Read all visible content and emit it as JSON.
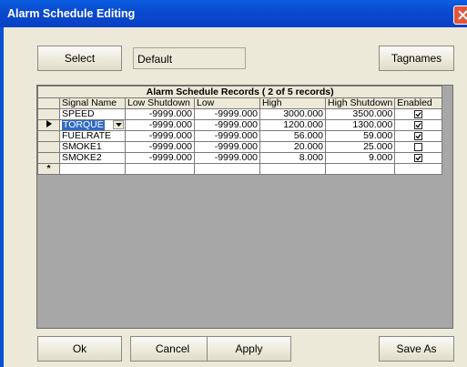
{
  "window": {
    "title": "Alarm Schedule Editing",
    "accent": "#0a4bd0"
  },
  "top": {
    "select_label": "Select",
    "schedule_value": "Default",
    "tagnames_label": "Tagnames"
  },
  "grid": {
    "caption": "Alarm Schedule Records ( 2 of 5 records)",
    "columns": [
      "Signal Name",
      "Low Shutdown",
      "Low",
      "High",
      "High Shutdown",
      "Enabled"
    ],
    "rows": [
      {
        "signal": "SPEED",
        "low_shutdown": "-9999.000",
        "low": "-9999.000",
        "high": "3000.000",
        "high_shutdown": "3500.000",
        "enabled": true,
        "current": false
      },
      {
        "signal": "TORQUE",
        "low_shutdown": "-9999.000",
        "low": "-9999.000",
        "high": "1200.000",
        "high_shutdown": "1300.000",
        "enabled": true,
        "current": true
      },
      {
        "signal": "FUELRATE",
        "low_shutdown": "-9999.000",
        "low": "-9999.000",
        "high": "56.000",
        "high_shutdown": "59.000",
        "enabled": true,
        "current": false
      },
      {
        "signal": "SMOKE1",
        "low_shutdown": "-9999.000",
        "low": "-9999.000",
        "high": "20.000",
        "high_shutdown": "25.000",
        "enabled": false,
        "current": false
      },
      {
        "signal": "SMOKE2",
        "low_shutdown": "-9999.000",
        "low": "-9999.000",
        "high": "8.000",
        "high_shutdown": "9.000",
        "enabled": true,
        "current": false
      }
    ],
    "new_row_marker": "*",
    "current_row_marker": "right-triangle-icon"
  },
  "bottom": {
    "ok_label": "Ok",
    "cancel_label": "Cancel",
    "apply_label": "Apply",
    "saveas_label": "Save As"
  }
}
